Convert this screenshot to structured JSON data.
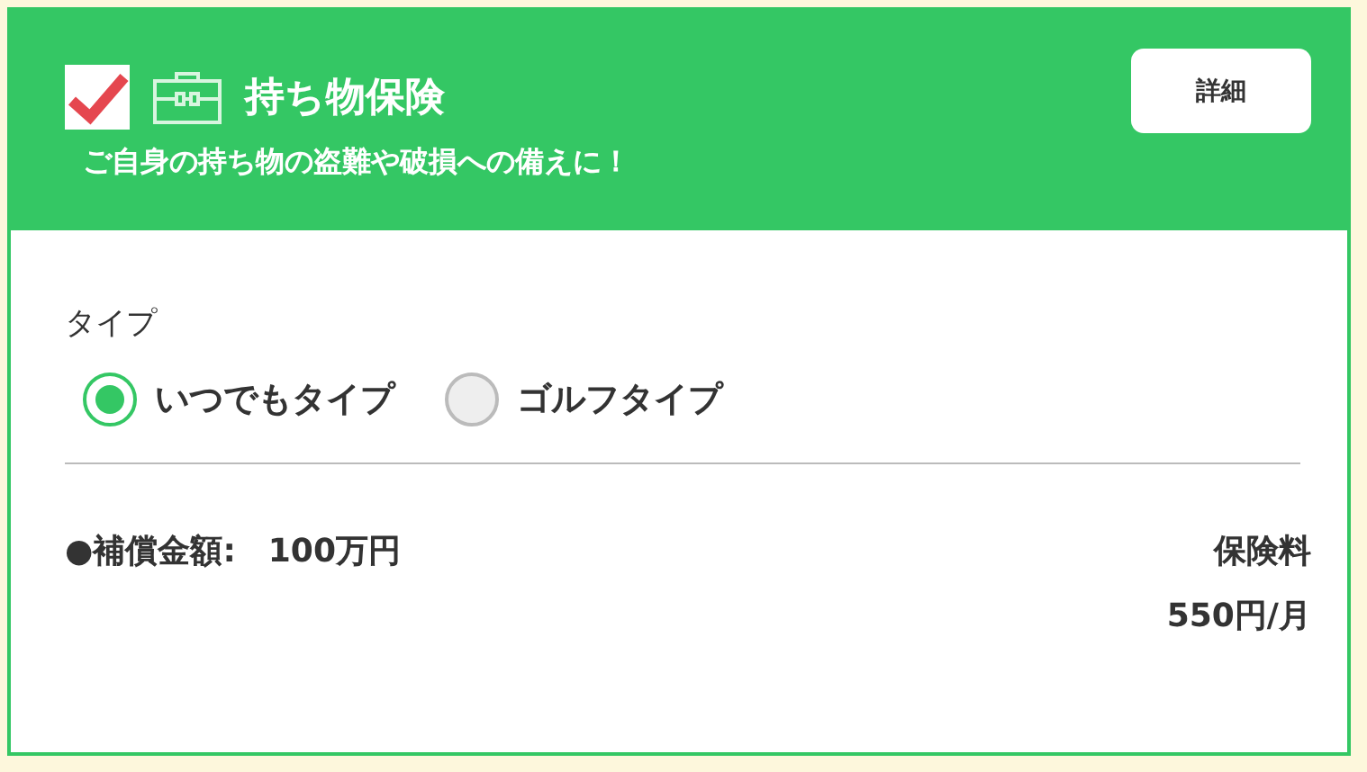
{
  "plan": {
    "checked": true,
    "title": "持ち物保険",
    "subtitle": "ご自身の持ち物の盗難や破損への備えに！",
    "details_button": "詳細"
  },
  "type_section": {
    "label": "タイプ",
    "options": [
      {
        "label": "いつでもタイプ",
        "selected": true
      },
      {
        "label": "ゴルフタイプ",
        "selected": false
      }
    ]
  },
  "coverage": {
    "label": "●補償金額:",
    "value": "100万円"
  },
  "premium": {
    "label": "保険料",
    "value": "550円/月"
  }
}
